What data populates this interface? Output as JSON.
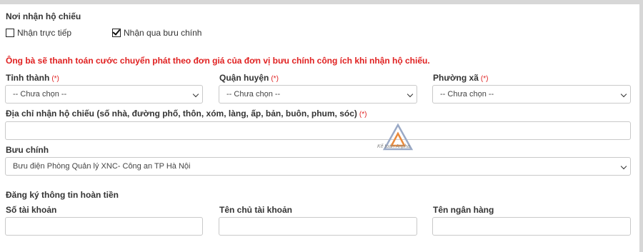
{
  "receive": {
    "title": "Nơi nhận hộ chiếu",
    "options": [
      {
        "label": "Nhận trực tiếp",
        "checked": false
      },
      {
        "label": "Nhận qua bưu chính",
        "checked": true
      }
    ],
    "notice": "Ông bà sẽ thanh toán cước chuyển phát theo đơn giá của đơn vị bưu chính công ích khi nhận hộ chiếu."
  },
  "address": {
    "province": {
      "label": "Tỉnh thành",
      "required": "(*)",
      "value": "-- Chưa chọn --"
    },
    "district": {
      "label": "Quận huyện",
      "required": "(*)",
      "value": "-- Chưa chọn --"
    },
    "ward": {
      "label": "Phường xã",
      "required": "(*)",
      "value": "-- Chưa chọn --"
    },
    "detail": {
      "label": "Địa chỉ nhận hộ chiếu (số nhà, đường phố, thôn, xóm, làng, ấp, bản, buôn, phum, sóc)",
      "required": "(*)",
      "value": ""
    }
  },
  "post": {
    "label": "Bưu chính",
    "value": "Bưu điện Phòng Quản lý XNC- Công an TP Hà Nội"
  },
  "refund": {
    "title": "Đăng ký thông tin hoàn tiền",
    "account_number": {
      "label": "Số tài khoản",
      "value": ""
    },
    "account_holder": {
      "label": "Tên chủ tài khoản",
      "value": ""
    },
    "bank_name": {
      "label": "Tên ngân hàng",
      "value": ""
    }
  },
  "watermark": {
    "text": "Kế toán Anpha",
    "accent": "#e98a3c"
  },
  "colors": {
    "required": "#e02020",
    "border": "#c9c9c9"
  }
}
